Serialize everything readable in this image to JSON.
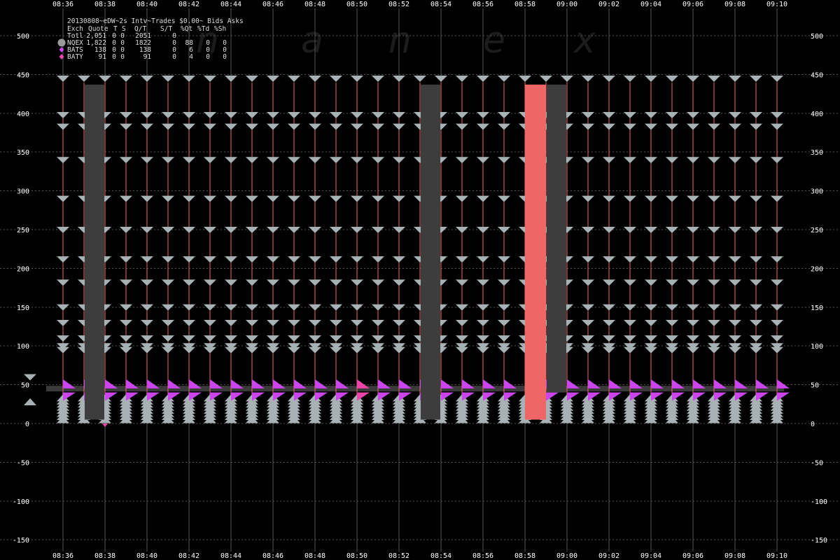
{
  "watermark": [
    "n",
    "a",
    "n",
    "e",
    "x"
  ],
  "legend": {
    "title": "20130808~eDW~2s Intv~Trades $0.00~ Bids  Asks",
    "header": [
      "Exch",
      "Quote",
      "T",
      "S",
      "Q/T",
      "S/T",
      "%Qt",
      "%Td",
      "%Sh"
    ],
    "rows": [
      {
        "exch": "Totl",
        "quote": "2,051",
        "t": "0",
        "s": "0",
        "qt": "2051",
        "st": "0",
        "pqt": "",
        "ptd": "",
        "psh": "",
        "marker": "none",
        "color": ""
      },
      {
        "exch": "NQEX",
        "quote": "1,822",
        "t": "0",
        "s": "0",
        "qt": "1822",
        "st": "0",
        "pqt": "88",
        "ptd": "0",
        "psh": "0",
        "marker": "circle",
        "color": "#9a9a9a"
      },
      {
        "exch": "BATS",
        "quote": "138",
        "t": "0",
        "s": "0",
        "qt": "138",
        "st": "0",
        "pqt": "6",
        "ptd": "0",
        "psh": "0",
        "marker": "diamond",
        "color": "#cc44ee"
      },
      {
        "exch": "BATY",
        "quote": "91",
        "t": "0",
        "s": "0",
        "qt": "91",
        "st": "0",
        "pqt": "4",
        "ptd": "0",
        "psh": "0",
        "marker": "diamond",
        "color": "#ee44aa"
      }
    ]
  },
  "chart_data": {
    "type": "scatter",
    "x_ticks": [
      "08:36",
      "08:38",
      "08:40",
      "08:42",
      "08:44",
      "08:46",
      "08:48",
      "08:50",
      "08:52",
      "08:54",
      "08:56",
      "08:58",
      "09:00",
      "09:02",
      "09:04",
      "09:06",
      "09:08",
      "09:10"
    ],
    "y_ticks": [
      500,
      450,
      400,
      350,
      300,
      250,
      200,
      150,
      100,
      50,
      0,
      -50,
      -100,
      -150
    ],
    "ylim": [
      -150,
      500
    ],
    "xlim_minutes": [
      515.1,
      551
    ],
    "grid": true,
    "time_start": "08:35",
    "interval_minutes": 1,
    "intervals": 35,
    "nqex_ask_levels": [
      445,
      398,
      383,
      340,
      290,
      250,
      212,
      182,
      150,
      130,
      110,
      100,
      95
    ],
    "nqex_bid_levels": [
      33,
      29,
      25,
      21,
      17,
      13,
      9,
      5
    ],
    "bats_ask": 47,
    "bats_bid": 40,
    "bid_ask_midline": 45,
    "gray_bars": [
      {
        "time": "08:38",
        "low": 5,
        "high": 437
      },
      {
        "time": "08:54",
        "low": 5,
        "high": 437
      },
      {
        "time": "09:00",
        "low": 40,
        "high": 437
      }
    ],
    "red_bars": [
      {
        "time": "08:59",
        "low": 5,
        "high": 437
      }
    ],
    "outlier_quotes": [
      {
        "time": "08:35",
        "price": 60,
        "side": "ask"
      },
      {
        "time": "08:35",
        "price": 28,
        "side": "bid"
      }
    ],
    "series": [
      {
        "name": "NQEX",
        "color": "#a8b2b4"
      },
      {
        "name": "BATS",
        "color": "#cc44ee"
      },
      {
        "name": "BATY",
        "color": "#ee44aa"
      }
    ],
    "colors": {
      "background": "#000000",
      "grid": "#555555",
      "trade_line": "#f06666",
      "gray_bar": "#3d3d3d",
      "red_bar": "#f06666",
      "midline": "#3a3a3a"
    }
  }
}
